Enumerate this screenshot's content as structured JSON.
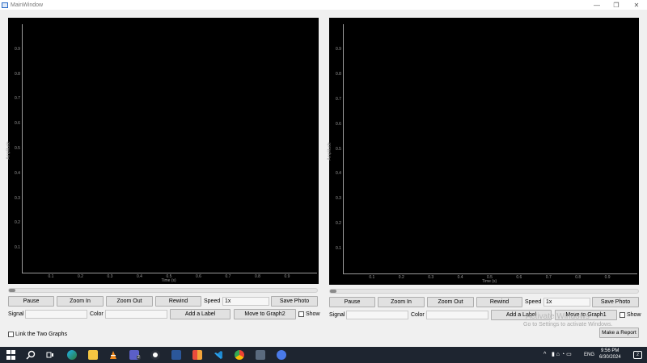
{
  "window": {
    "title": "MainWindow",
    "minimize": "—",
    "maximize": "❐",
    "close": "✕"
  },
  "plot_common": {
    "y_ticks": [
      "0.9",
      "0.8",
      "0.7",
      "0.6",
      "0.5",
      "0.4",
      "0.3",
      "0.2",
      "0.1"
    ],
    "x_ticks": [
      "0.1",
      "0.2",
      "0.3",
      "0.4",
      "0.5",
      "0.6",
      "0.7",
      "0.8",
      "0.9"
    ],
    "y_label": "Amplitude",
    "x_label": "Time (s)"
  },
  "graph1": {
    "buttons": {
      "pause": "Pause",
      "zoom_in": "Zoom In",
      "zoom_out": "Zoom Out",
      "rewind": "Rewind",
      "save_photo": "Save Photo",
      "add_label": "Add a Label",
      "move": "Move to Graph2"
    },
    "speed_label": "Speed",
    "speed_value": "1x",
    "signal_label": "Signal",
    "signal_value": "",
    "color_label": "Color",
    "color_value": "",
    "show_label": "Show"
  },
  "graph2": {
    "buttons": {
      "pause": "Pause",
      "zoom_in": "Zoom In",
      "zoom_out": "Zoom Out",
      "rewind": "Rewind",
      "save_photo": "Save Photo",
      "add_label": "Add a Label",
      "move": "Move to Graph1"
    },
    "speed_label": "Speed",
    "speed_value": "1x",
    "signal_label": "Signal",
    "signal_value": "",
    "color_label": "Color",
    "color_value": "",
    "show_label": "Show"
  },
  "link_label": "Link the Two Graphs",
  "report_button": "Make a Report",
  "watermark": {
    "line1": "Activate Windows",
    "line2": "Go to Settings to activate Windows."
  },
  "taskbar": {
    "icons": [
      "windows-start-icon",
      "search-icon",
      "task-view-icon",
      "edge-icon",
      "file-explorer-icon",
      "vlc-icon",
      "teams-icon",
      "obs-icon",
      "word-icon",
      "app-grid-icon",
      "vscode-icon",
      "chrome-icon",
      "steam-icon",
      "discord-icon"
    ],
    "badge1": "2",
    "lang": "ENG",
    "time": "9:56 PM",
    "date": "6/30/2024",
    "notif_count": "2"
  }
}
